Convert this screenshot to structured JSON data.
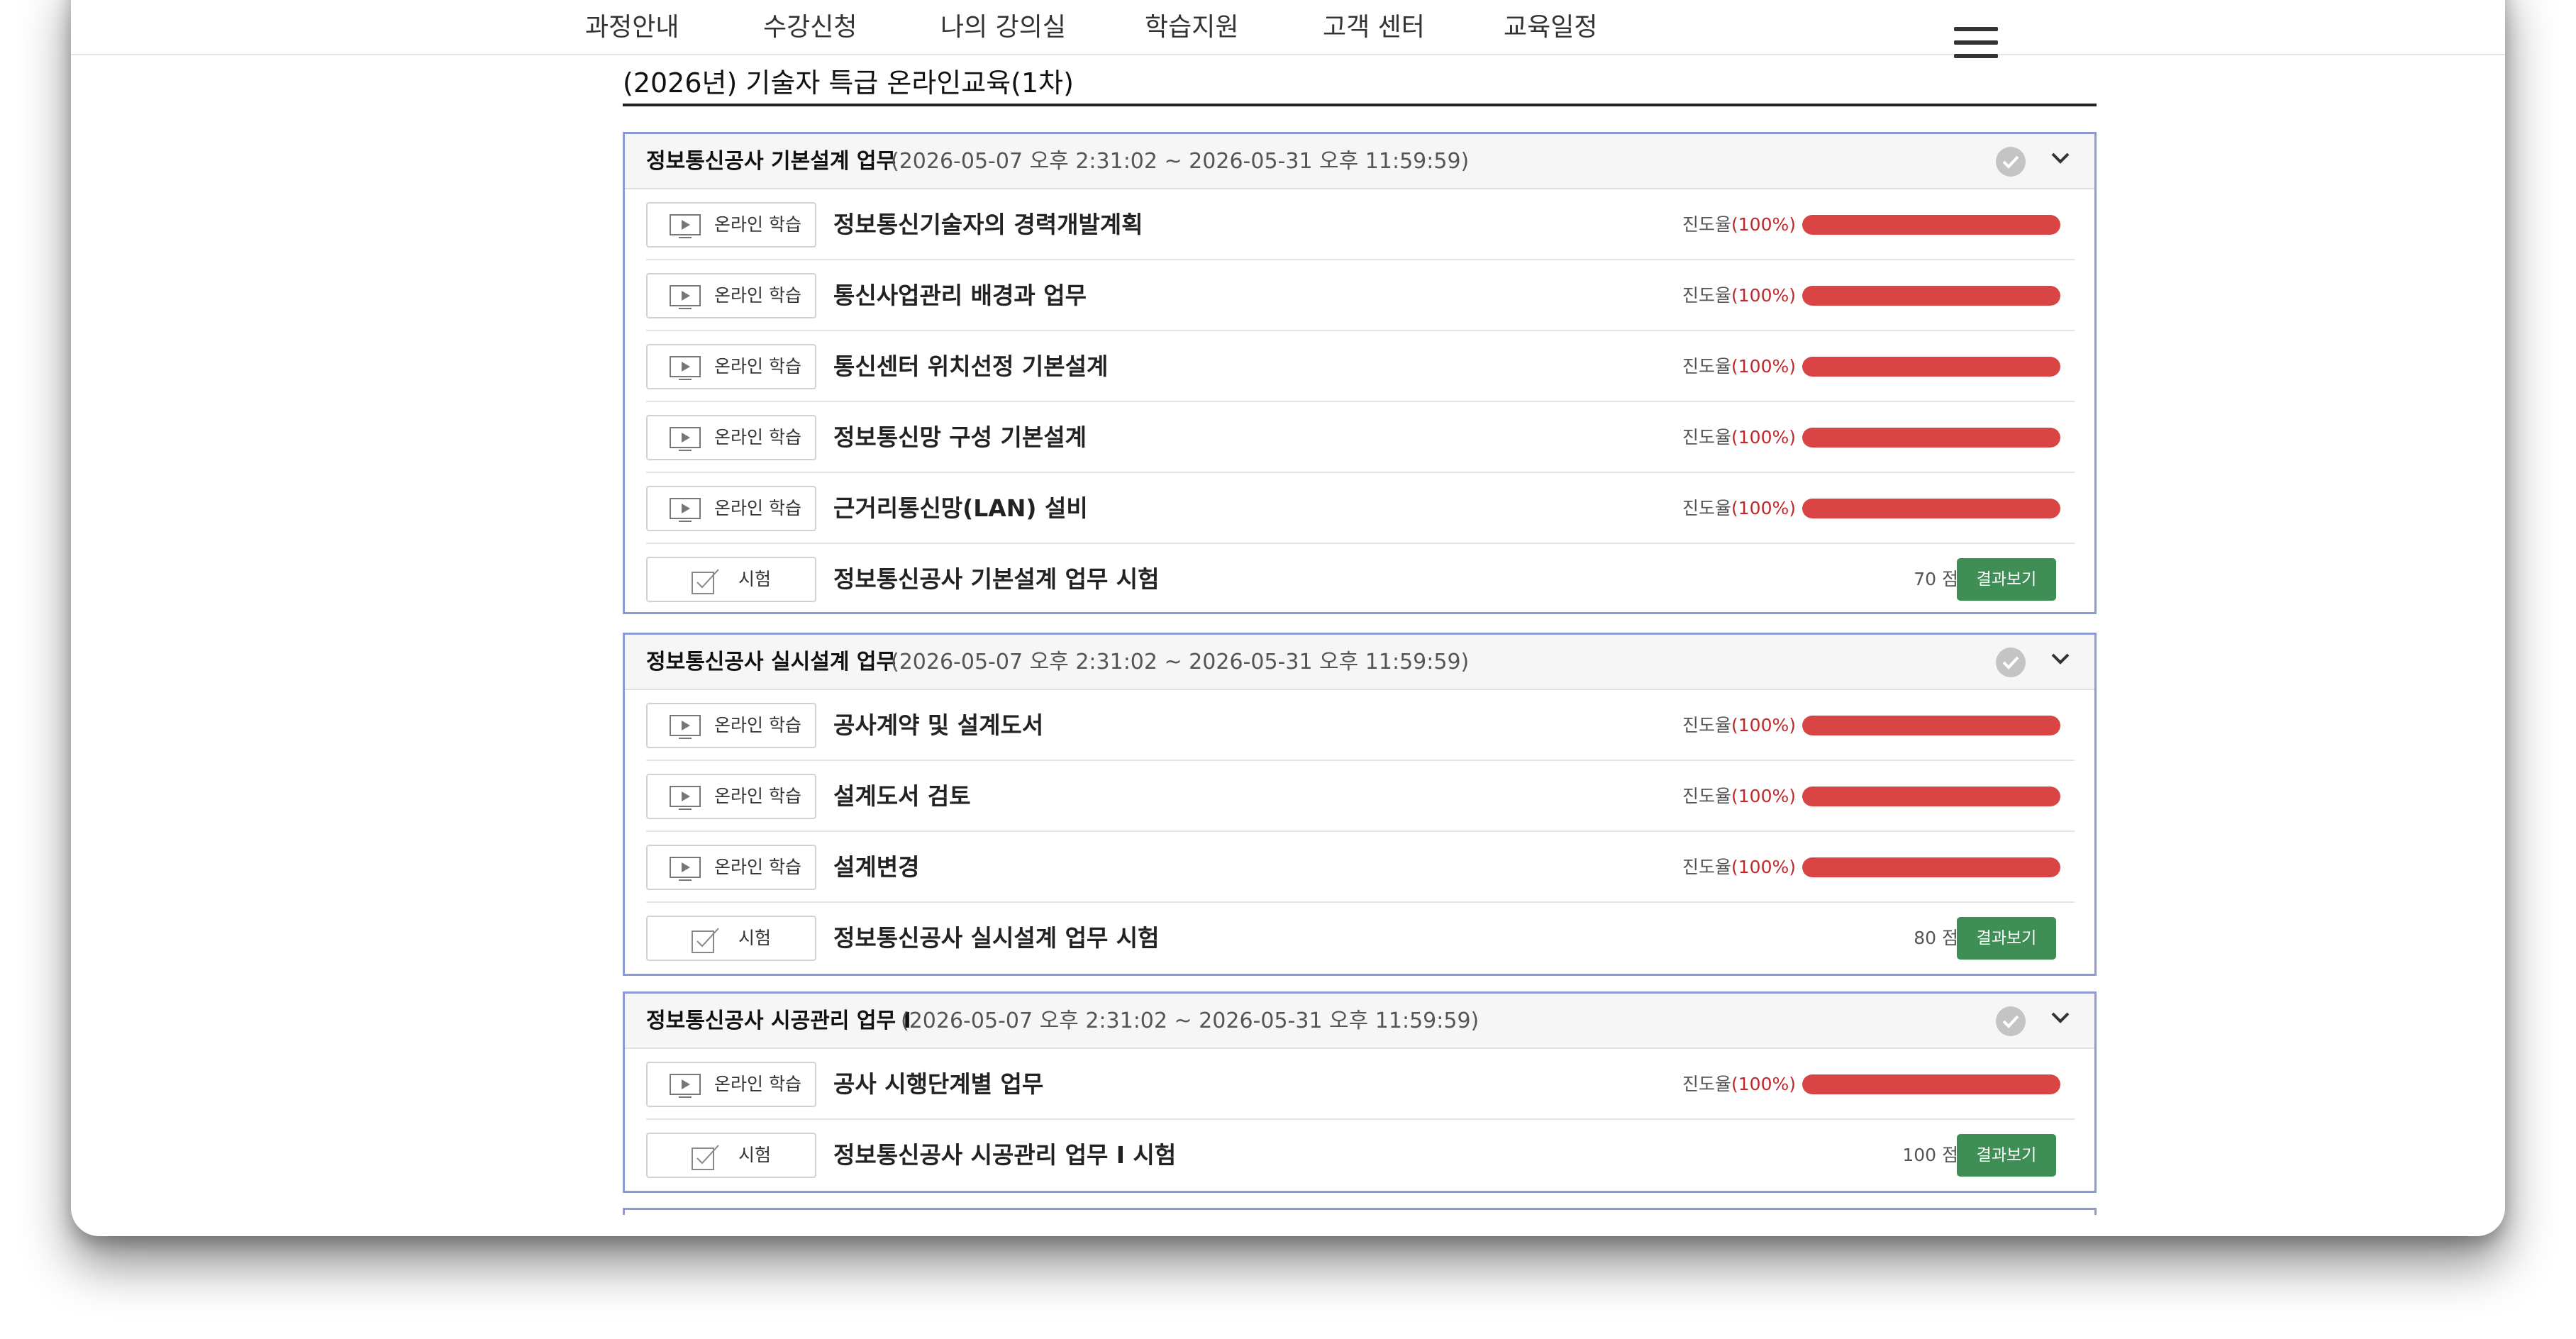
{
  "nav": {
    "items": [
      {
        "label": "과정안내"
      },
      {
        "label": "수강신청"
      },
      {
        "label": "나의 강의실"
      },
      {
        "label": "학습지원"
      },
      {
        "label": "고객 센터"
      },
      {
        "label": "교육일정"
      }
    ],
    "menu_icon": "hamburger-menu-icon"
  },
  "page": {
    "title": "(2026년) 기술자 특급 온라인교육(1차)"
  },
  "modules": [
    {
      "name": "정보통신공사 기본설계 업무",
      "period": "(2026-05-07 오후 2:31:02 ~ 2026-05-31 오후 11:59:59)",
      "items": [
        {
          "type": "lecture",
          "type_label": "온라인 학습",
          "title": "정보통신기술자의 경력개발계획",
          "progress_label": "진도율",
          "progress_text": "(100%)",
          "progress": 1.0
        },
        {
          "type": "lecture",
          "type_label": "온라인 학습",
          "title": "통신사업관리 배경과 업무",
          "progress_label": "진도율",
          "progress_text": "(100%)",
          "progress": 1.0
        },
        {
          "type": "lecture",
          "type_label": "온라인 학습",
          "title": "통신센터 위치선정 기본설계",
          "progress_label": "진도율",
          "progress_text": "(100%)",
          "progress": 1.0
        },
        {
          "type": "lecture",
          "type_label": "온라인 학습",
          "title": "정보통신망 구성 기본설계",
          "progress_label": "진도율",
          "progress_text": "(100%)",
          "progress": 1.0
        },
        {
          "type": "lecture",
          "type_label": "온라인 학습",
          "title": "근거리통신망(LAN) 설비",
          "progress_label": "진도율",
          "progress_text": "(100%)",
          "progress": 1.0
        },
        {
          "type": "exam",
          "type_label": "시험",
          "title": "정보통신공사 기본설계 업무 시험",
          "score_text": "70 점",
          "button_label": "결과보기"
        }
      ]
    },
    {
      "name": "정보통신공사 실시설계 업무",
      "period": "(2026-05-07 오후 2:31:02 ~ 2026-05-31 오후 11:59:59)",
      "items": [
        {
          "type": "lecture",
          "type_label": "온라인 학습",
          "title": "공사계약 및 설계도서",
          "progress_label": "진도율",
          "progress_text": "(100%)",
          "progress": 1.0
        },
        {
          "type": "lecture",
          "type_label": "온라인 학습",
          "title": "설계도서 검토",
          "progress_label": "진도율",
          "progress_text": "(100%)",
          "progress": 1.0
        },
        {
          "type": "lecture",
          "type_label": "온라인 학습",
          "title": "설계변경",
          "progress_label": "진도율",
          "progress_text": "(100%)",
          "progress": 1.0
        },
        {
          "type": "exam",
          "type_label": "시험",
          "title": "정보통신공사 실시설계 업무 시험",
          "score_text": "80 점",
          "button_label": "결과보기"
        }
      ]
    },
    {
      "name": "정보통신공사 시공관리 업무 I",
      "period": "(2026-05-07 오후 2:31:02 ~ 2026-05-31 오후 11:59:59)",
      "items": [
        {
          "type": "lecture",
          "type_label": "온라인 학습",
          "title": "공사 시행단계별 업무",
          "progress_label": "진도율",
          "progress_text": "(100%)",
          "progress": 1.0
        },
        {
          "type": "exam",
          "type_label": "시험",
          "title": "정보통신공사 시공관리 업무 I 시험",
          "score_text": "100 점",
          "button_label": "결과보기"
        }
      ]
    }
  ],
  "colors": {
    "panel_border": "#8c9bd6",
    "progress_fill": "#d94444",
    "result_button": "#3e8e56",
    "percent_text": "#c0282b"
  }
}
